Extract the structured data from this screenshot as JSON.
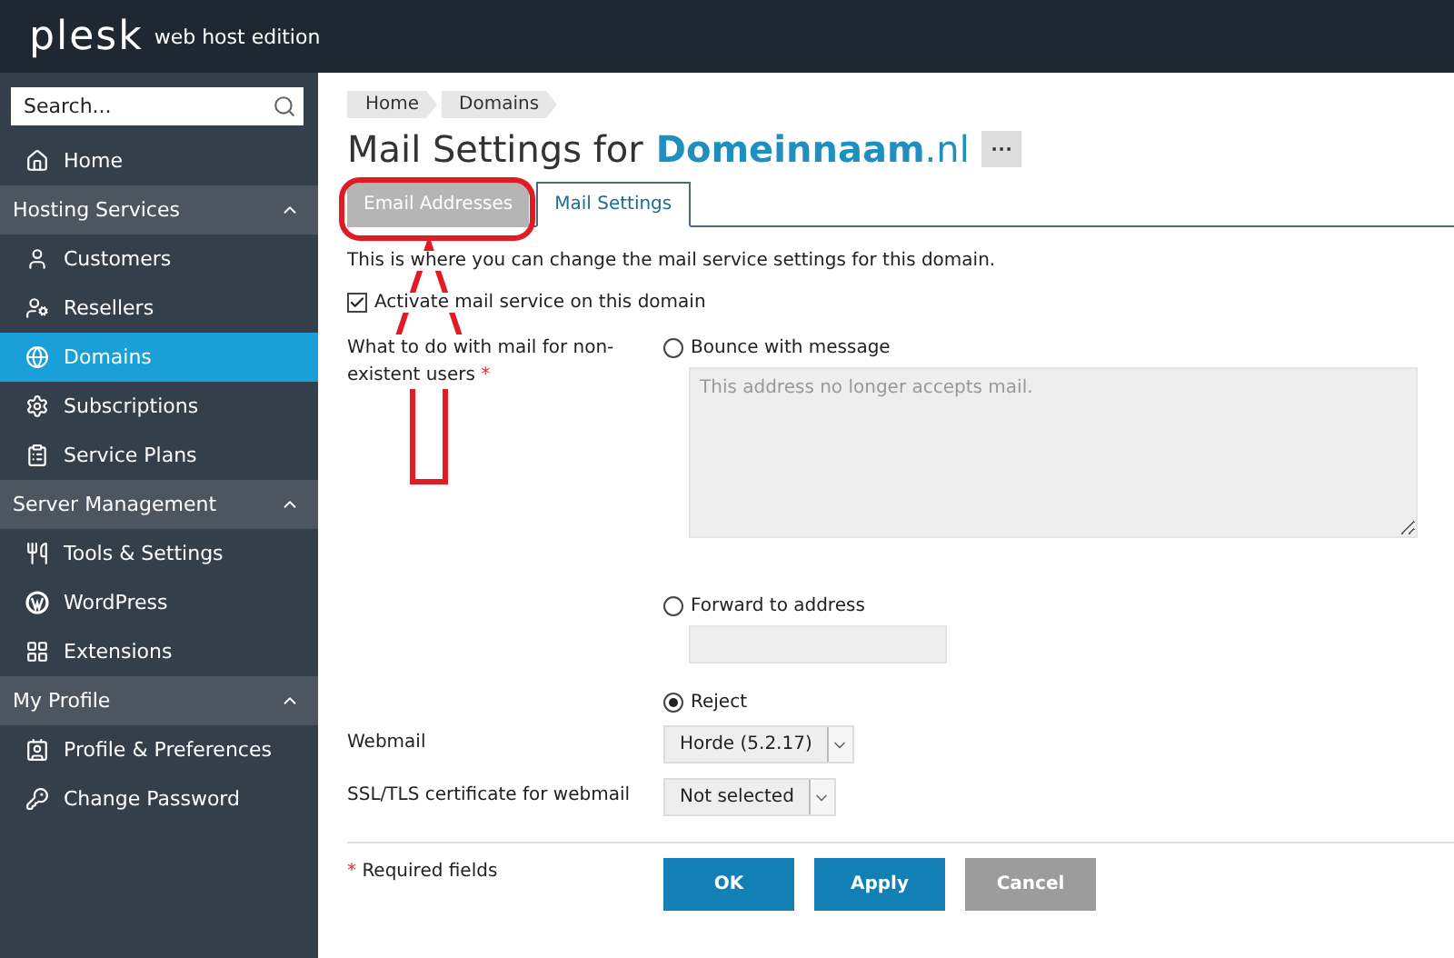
{
  "header": {
    "logo": "plesk",
    "edition": "web host edition"
  },
  "sidebar": {
    "search": {
      "placeholder": "Search..."
    },
    "nav": [
      {
        "kind": "item",
        "label": "Home",
        "selected": false
      },
      {
        "kind": "section",
        "label": "Hosting Services",
        "expanded": true,
        "children": [
          {
            "label": "Customers",
            "selected": false
          },
          {
            "label": "Resellers",
            "selected": false
          },
          {
            "label": "Domains",
            "selected": true
          },
          {
            "label": "Subscriptions",
            "selected": false
          },
          {
            "label": "Service Plans",
            "selected": false
          }
        ]
      },
      {
        "kind": "section",
        "label": "Server Management",
        "expanded": true,
        "children": [
          {
            "label": "Tools & Settings",
            "selected": false
          },
          {
            "label": "WordPress",
            "selected": false
          },
          {
            "label": "Extensions",
            "selected": false
          }
        ]
      },
      {
        "kind": "section",
        "label": "My Profile",
        "expanded": true,
        "children": [
          {
            "label": "Profile & Preferences",
            "selected": false
          },
          {
            "label": "Change Password",
            "selected": false
          }
        ]
      }
    ]
  },
  "breadcrumbs": [
    "Home",
    "Domains"
  ],
  "title": {
    "prefix": "Mail Settings for",
    "domain": "Domeinnaam",
    "tld": ".nl",
    "more": "···"
  },
  "tabs": [
    {
      "label": "Email Addresses",
      "selected": false
    },
    {
      "label": "Mail Settings",
      "selected": true
    }
  ],
  "description": "This is where you can change the mail service settings for this domain.",
  "activate": {
    "label": "Activate mail service on this domain",
    "checked": true
  },
  "nonexistent": {
    "label": "What to do with mail for non-existent users",
    "required": "*",
    "options": [
      {
        "kind": "message",
        "label": "Bounce with message",
        "selected": false,
        "placeholder": "This address no longer accepts mail."
      },
      {
        "kind": "address",
        "label": "Forward to address",
        "selected": false
      },
      {
        "kind": "plain",
        "label": "Reject",
        "selected": true
      }
    ]
  },
  "selects": [
    {
      "label": "Webmail",
      "value": "Horde (5.2.17)"
    },
    {
      "label": "SSL/TLS certificate for webmail",
      "value": "Not selected"
    }
  ],
  "required_note": {
    "mark": "*",
    "text": "Required fields"
  },
  "buttons": [
    {
      "label": "OK",
      "kind": "primary"
    },
    {
      "label": "Apply",
      "kind": "primary"
    },
    {
      "label": "Cancel",
      "kind": "secondary"
    }
  ]
}
